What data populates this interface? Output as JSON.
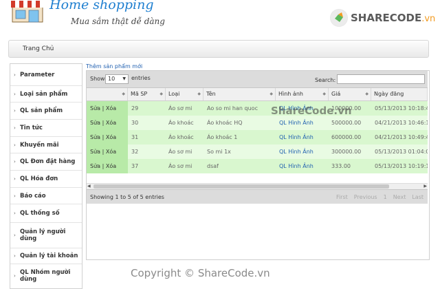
{
  "header": {
    "brand_title": "Home shopping",
    "brand_subtitle": "Mua sắm thật dễ dàng",
    "sharecode_main": "SHARECODE",
    "sharecode_suffix": ".vn"
  },
  "breadcrumb": {
    "home": "Trang Chủ"
  },
  "sidebar": {
    "items": [
      {
        "label": "Parameter"
      },
      {
        "label": "Loại sản phẩm"
      },
      {
        "label": "QL sản phẩm"
      },
      {
        "label": "Tin tức"
      },
      {
        "label": "Khuyến mãi"
      },
      {
        "label": "QL Đơn đặt hàng"
      },
      {
        "label": "QL Hóa đơn"
      },
      {
        "label": "Báo cáo"
      },
      {
        "label": "QL thống số"
      },
      {
        "label": "Quản lý người dùng"
      },
      {
        "label": "Quản lý tài khoản"
      },
      {
        "label": "QL Nhóm người dùng"
      }
    ]
  },
  "content": {
    "add_link": "Thêm sản phẩm mới",
    "show_label": "Show",
    "page_length": "10",
    "entries_label": "entries",
    "search_label": "Search:",
    "columns": [
      "",
      "Mã SP",
      "Loại",
      "Tên",
      "Hình ảnh",
      "Giá",
      "Ngày đăng"
    ],
    "rows": [
      {
        "action": "Sửa | Xóa",
        "id": "29",
        "type": "Áo sơ mi",
        "name": "Ao so mi han quoc",
        "image": "QL Hình Ảnh",
        "price": "100000.00",
        "date": "05/13/2013 10:18:44 PM"
      },
      {
        "action": "Sửa | Xóa",
        "id": "30",
        "type": "Áo khoác",
        "name": "Áo khoác HQ",
        "image": "QL Hình Ảnh",
        "price": "500000.00",
        "date": "04/21/2013 10:46:15 PM"
      },
      {
        "action": "Sửa | Xóa",
        "id": "31",
        "type": "Áo khoác",
        "name": "Áo khoác 1",
        "image": "QL Hình Ảnh",
        "price": "600000.00",
        "date": "04/21/2013 10:49:40 PM"
      },
      {
        "action": "Sửa | Xóa",
        "id": "32",
        "type": "Áo sơ mi",
        "name": "So mi 1x",
        "image": "QL Hình Ảnh",
        "price": "300000.00",
        "date": "05/13/2013 01:04:07 AM"
      },
      {
        "action": "Sửa | Xóa",
        "id": "37",
        "type": "Áo sơ mi",
        "name": "dsaf",
        "image": "QL Hình Ảnh",
        "price": "333.00",
        "date": "05/13/2013 10:19:16 PM"
      }
    ],
    "info": "Showing 1 to 5 of 5 entries",
    "pager": {
      "first": "First",
      "previous": "Previous",
      "page": "1",
      "next": "Next",
      "last": "Last"
    }
  },
  "watermark": {
    "center": "ShareCode.vn",
    "bottom": "Copyright © ShareCode.vn"
  },
  "colors": {
    "brand_blue": "#1f7fd0",
    "row_green": "#d9f7cf",
    "row_green_alt": "#e9fbe3",
    "action_green": "#b8eaa8",
    "link_blue": "#1f5fb0",
    "sharecode_orange": "#f29a1f"
  }
}
